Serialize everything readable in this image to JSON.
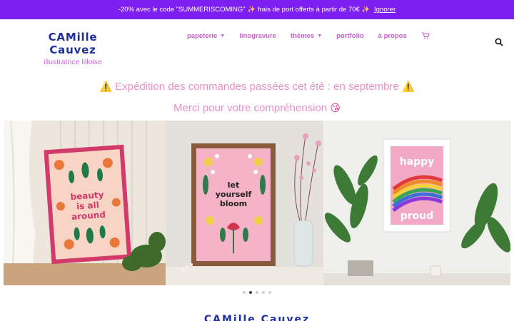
{
  "promo": {
    "text_before": "-20% avec le code \"SUMMERISCOMING\"",
    "sparkle": "✨",
    "text_after": "frais de port offerts à partir de 70€",
    "dismiss": "Ignorer"
  },
  "header": {
    "brand": "CAMille Cauvez",
    "tagline": "illustratrice lilloise",
    "nav": [
      {
        "label": "papeterie",
        "dropdown": true
      },
      {
        "label": "linogravure",
        "dropdown": false
      },
      {
        "label": "thèmes",
        "dropdown": true
      },
      {
        "label": "portfolio",
        "dropdown": false
      },
      {
        "label": "à propos",
        "dropdown": false
      }
    ],
    "cart_icon": "cart-icon",
    "search_icon": "search-icon"
  },
  "notice": {
    "warning_icon": "⚠️",
    "line1": "Expédition des commandes passées cet été : en septembre",
    "line2": "Merci pour votre compréhension",
    "emoji": "😘"
  },
  "slides": [
    {
      "poster_text": [
        "beauty",
        "is all",
        "around"
      ]
    },
    {
      "poster_text": [
        "let",
        "yourself",
        "bloom"
      ]
    },
    {
      "poster_text": [
        "happy",
        "proud"
      ]
    }
  ],
  "slider": {
    "count": 5,
    "active_index": 1
  },
  "footer_peek": "CAMille Cauvez",
  "colors": {
    "promo_bg": "#7d1ff0",
    "brand_blue": "#1f2e9e",
    "nav_pink": "#c95ec9",
    "notice_pink": "#e88ec8"
  }
}
